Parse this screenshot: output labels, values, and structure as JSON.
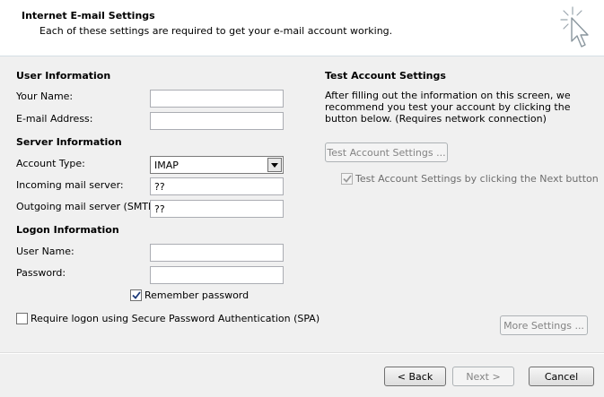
{
  "header": {
    "title": "Internet E-mail Settings",
    "subtitle": "Each of these settings are required to get your e-mail account working.",
    "icon": "wizard-cursor-icon"
  },
  "user_info": {
    "heading": "User Information",
    "name_label": "Your Name:",
    "name_value": "",
    "email_label": "E-mail Address:",
    "email_value": ""
  },
  "server_info": {
    "heading": "Server Information",
    "account_type_label": "Account Type:",
    "account_type_value": "IMAP",
    "incoming_label": "Incoming mail server:",
    "incoming_value": "??",
    "outgoing_label": "Outgoing mail server (SMTP):",
    "outgoing_value": "??"
  },
  "logon_info": {
    "heading": "Logon Information",
    "username_label": "User Name:",
    "username_value": "",
    "password_label": "Password:",
    "password_value": "",
    "remember_label": "Remember password",
    "remember_checked": true,
    "spa_label": "Require logon using Secure Password Authentication (SPA)",
    "spa_checked": false
  },
  "test_settings": {
    "heading": "Test Account Settings",
    "description": "After filling out the information on this screen, we recommend you test your account by clicking the button below. (Requires network connection)",
    "test_button": "Test Account Settings ...",
    "next_test_label": "Test Account Settings by clicking the Next button",
    "next_test_checked": true
  },
  "buttons": {
    "more_settings": "More Settings ...",
    "back": "< Back",
    "next": "Next >",
    "cancel": "Cancel"
  }
}
